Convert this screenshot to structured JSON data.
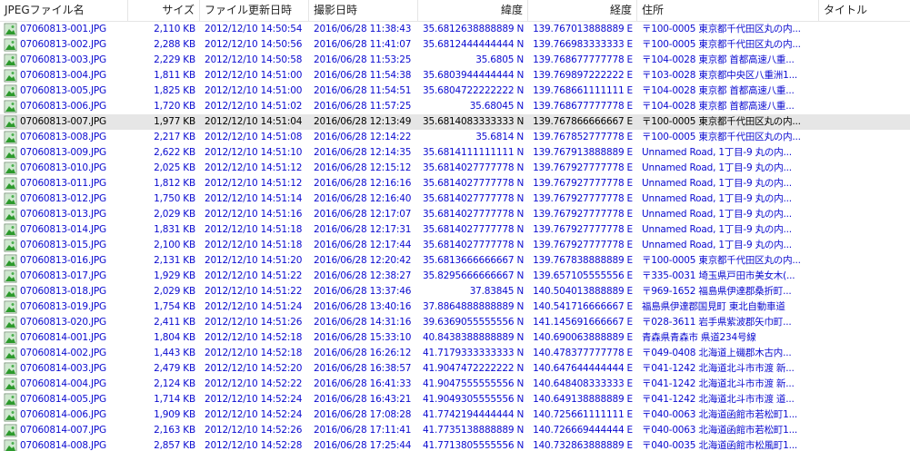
{
  "columns": [
    "JPEGファイル名",
    "サイズ",
    "ファイル更新日時",
    "撮影日時",
    "緯度",
    "経度",
    "住所",
    "タイトル"
  ],
  "selected_index": 6,
  "rows": [
    {
      "name": "07060813-001.JPG",
      "size": "2,110 KB",
      "modified": "2012/12/10 14:50:54",
      "taken": "2016/06/28 11:38:43",
      "lat": "35.6812638888889 N",
      "lon": "139.767013888889 E",
      "address": "〒100-0005 東京都千代田区丸の内..."
    },
    {
      "name": "07060813-002.JPG",
      "size": "2,288 KB",
      "modified": "2012/12/10 14:50:56",
      "taken": "2016/06/28 11:41:07",
      "lat": "35.6812444444444 N",
      "lon": "139.766983333333 E",
      "address": "〒100-0005 東京都千代田区丸の内..."
    },
    {
      "name": "07060813-003.JPG",
      "size": "2,229 KB",
      "modified": "2012/12/10 14:50:58",
      "taken": "2016/06/28 11:53:25",
      "lat": "35.6805 N",
      "lon": "139.768677777778 E",
      "address": "〒104-0028 東京都 首都高速八重..."
    },
    {
      "name": "07060813-004.JPG",
      "size": "1,811 KB",
      "modified": "2012/12/10 14:51:00",
      "taken": "2016/06/28 11:54:38",
      "lat": "35.6803944444444 N",
      "lon": "139.769897222222 E",
      "address": "〒103-0028 東京都中央区八重洲1..."
    },
    {
      "name": "07060813-005.JPG",
      "size": "1,825 KB",
      "modified": "2012/12/10 14:51:00",
      "taken": "2016/06/28 11:54:51",
      "lat": "35.6804722222222 N",
      "lon": "139.768661111111 E",
      "address": "〒104-0028 東京都 首都高速八重..."
    },
    {
      "name": "07060813-006.JPG",
      "size": "1,720 KB",
      "modified": "2012/12/10 14:51:02",
      "taken": "2016/06/28 11:57:25",
      "lat": "35.68045 N",
      "lon": "139.768677777778 E",
      "address": "〒104-0028 東京都 首都高速八重..."
    },
    {
      "name": "07060813-007.JPG",
      "size": "1,977 KB",
      "modified": "2012/12/10 14:51:04",
      "taken": "2016/06/28 12:13:49",
      "lat": "35.6814083333333 N",
      "lon": "139.767866666667 E",
      "address": "〒100-0005 東京都千代田区丸の内..."
    },
    {
      "name": "07060813-008.JPG",
      "size": "2,217 KB",
      "modified": "2012/12/10 14:51:08",
      "taken": "2016/06/28 12:14:22",
      "lat": "35.6814 N",
      "lon": "139.767852777778 E",
      "address": "〒100-0005 東京都千代田区丸の内..."
    },
    {
      "name": "07060813-009.JPG",
      "size": "2,622 KB",
      "modified": "2012/12/10 14:51:10",
      "taken": "2016/06/28 12:14:35",
      "lat": "35.6814111111111 N",
      "lon": "139.767913888889 E",
      "address": "Unnamed Road, 1丁目-9 丸の内..."
    },
    {
      "name": "07060813-010.JPG",
      "size": "2,025 KB",
      "modified": "2012/12/10 14:51:12",
      "taken": "2016/06/28 12:15:12",
      "lat": "35.6814027777778 N",
      "lon": "139.767927777778 E",
      "address": "Unnamed Road, 1丁目-9 丸の内..."
    },
    {
      "name": "07060813-011.JPG",
      "size": "1,812 KB",
      "modified": "2012/12/10 14:51:12",
      "taken": "2016/06/28 12:16:16",
      "lat": "35.6814027777778 N",
      "lon": "139.767927777778 E",
      "address": "Unnamed Road, 1丁目-9 丸の内..."
    },
    {
      "name": "07060813-012.JPG",
      "size": "1,750 KB",
      "modified": "2012/12/10 14:51:14",
      "taken": "2016/06/28 12:16:40",
      "lat": "35.6814027777778 N",
      "lon": "139.767927777778 E",
      "address": "Unnamed Road, 1丁目-9 丸の内..."
    },
    {
      "name": "07060813-013.JPG",
      "size": "2,029 KB",
      "modified": "2012/12/10 14:51:16",
      "taken": "2016/06/28 12:17:07",
      "lat": "35.6814027777778 N",
      "lon": "139.767927777778 E",
      "address": "Unnamed Road, 1丁目-9 丸の内..."
    },
    {
      "name": "07060813-014.JPG",
      "size": "1,831 KB",
      "modified": "2012/12/10 14:51:18",
      "taken": "2016/06/28 12:17:31",
      "lat": "35.6814027777778 N",
      "lon": "139.767927777778 E",
      "address": "Unnamed Road, 1丁目-9 丸の内..."
    },
    {
      "name": "07060813-015.JPG",
      "size": "2,100 KB",
      "modified": "2012/12/10 14:51:18",
      "taken": "2016/06/28 12:17:44",
      "lat": "35.6814027777778 N",
      "lon": "139.767927777778 E",
      "address": "Unnamed Road, 1丁目-9 丸の内..."
    },
    {
      "name": "07060813-016.JPG",
      "size": "2,131 KB",
      "modified": "2012/12/10 14:51:20",
      "taken": "2016/06/28 12:20:42",
      "lat": "35.6813666666667 N",
      "lon": "139.767838888889 E",
      "address": "〒100-0005 東京都千代田区丸の内..."
    },
    {
      "name": "07060813-017.JPG",
      "size": "1,929 KB",
      "modified": "2012/12/10 14:51:22",
      "taken": "2016/06/28 12:38:27",
      "lat": "35.8295666666667 N",
      "lon": "139.657105555556 E",
      "address": "〒335-0031 埼玉県戸田市美女木(..."
    },
    {
      "name": "07060813-018.JPG",
      "size": "2,029 KB",
      "modified": "2012/12/10 14:51:22",
      "taken": "2016/06/28 13:37:46",
      "lat": "37.83845 N",
      "lon": "140.504013888889 E",
      "address": "〒969-1652 福島県伊達郡桑折町..."
    },
    {
      "name": "07060813-019.JPG",
      "size": "1,754 KB",
      "modified": "2012/12/10 14:51:24",
      "taken": "2016/06/28 13:40:16",
      "lat": "37.8864888888889 N",
      "lon": "140.541716666667 E",
      "address": "福島県伊達郡国見町 東北自動車道"
    },
    {
      "name": "07060813-020.JPG",
      "size": "2,411 KB",
      "modified": "2012/12/10 14:51:26",
      "taken": "2016/06/28 14:31:16",
      "lat": "39.6369055555556 N",
      "lon": "141.145691666667 E",
      "address": "〒028-3611 岩手県紫波郡矢巾町..."
    },
    {
      "name": "07060814-001.JPG",
      "size": "1,804 KB",
      "modified": "2012/12/10 14:52:18",
      "taken": "2016/06/28 15:33:10",
      "lat": "40.8438388888889 N",
      "lon": "140.690063888889 E",
      "address": "青森県青森市 県道234号線"
    },
    {
      "name": "07060814-002.JPG",
      "size": "1,443 KB",
      "modified": "2012/12/10 14:52:18",
      "taken": "2016/06/28 16:26:12",
      "lat": "41.7179333333333 N",
      "lon": "140.478377777778 E",
      "address": "〒049-0408 北海道上磯郡木古内..."
    },
    {
      "name": "07060814-003.JPG",
      "size": "2,479 KB",
      "modified": "2012/12/10 14:52:20",
      "taken": "2016/06/28 16:38:57",
      "lat": "41.9047472222222 N",
      "lon": "140.647644444444 E",
      "address": "〒041-1242 北海道北斗市市渡 新..."
    },
    {
      "name": "07060814-004.JPG",
      "size": "2,124 KB",
      "modified": "2012/12/10 14:52:22",
      "taken": "2016/06/28 16:41:33",
      "lat": "41.9047555555556 N",
      "lon": "140.648408333333 E",
      "address": "〒041-1242 北海道北斗市市渡 新..."
    },
    {
      "name": "07060814-005.JPG",
      "size": "1,714 KB",
      "modified": "2012/12/10 14:52:24",
      "taken": "2016/06/28 16:43:21",
      "lat": "41.9049305555556 N",
      "lon": "140.649138888889 E",
      "address": "〒041-1242 北海道北斗市市渡 道..."
    },
    {
      "name": "07060814-006.JPG",
      "size": "1,909 KB",
      "modified": "2012/12/10 14:52:24",
      "taken": "2016/06/28 17:08:28",
      "lat": "41.7742194444444 N",
      "lon": "140.725661111111 E",
      "address": "〒040-0063 北海道函館市若松町1..."
    },
    {
      "name": "07060814-007.JPG",
      "size": "2,163 KB",
      "modified": "2012/12/10 14:52:26",
      "taken": "2016/06/28 17:11:41",
      "lat": "41.7735138888889 N",
      "lon": "140.726669444444 E",
      "address": "〒040-0063 北海道函館市若松町1..."
    },
    {
      "name": "07060814-008.JPG",
      "size": "2,857 KB",
      "modified": "2012/12/10 14:52:28",
      "taken": "2016/06/28 17:25:44",
      "lat": "41.7713805555556 N",
      "lon": "140.732863888889 E",
      "address": "〒040-0035 北海道函館市松風町1..."
    }
  ]
}
